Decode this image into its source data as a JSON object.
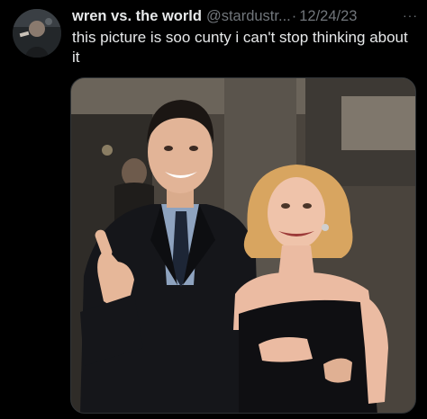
{
  "tweet": {
    "display_name": "wren vs. the world",
    "handle": "@stardustr...",
    "separator": "·",
    "date": "12/24/23",
    "more_label": "···",
    "text": "this picture is soo cunty i can't stop thinking about it"
  },
  "icons": {
    "avatar": "avatar-icon",
    "more": "more-options-icon"
  },
  "colors": {
    "background": "#000000",
    "primary_text": "#e7e9ea",
    "secondary_text": "#71767b",
    "border": "#2f3336"
  }
}
